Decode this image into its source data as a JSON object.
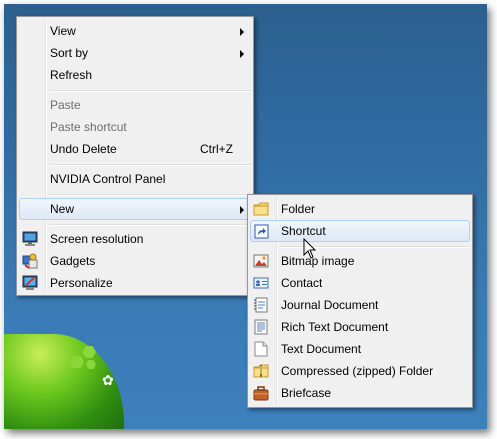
{
  "context_menu": {
    "items": [
      {
        "label": "View",
        "submenu": true
      },
      {
        "label": "Sort by",
        "submenu": true
      },
      {
        "label": "Refresh"
      },
      {
        "label": "Paste",
        "disabled": true
      },
      {
        "label": "Paste shortcut",
        "disabled": true
      },
      {
        "label": "Undo Delete",
        "shortcut": "Ctrl+Z"
      },
      {
        "label": "NVIDIA Control Panel"
      },
      {
        "label": "New",
        "submenu": true,
        "highlighted": true
      },
      {
        "label": "Screen resolution",
        "icon": "monitor-icon"
      },
      {
        "label": "Gadgets",
        "icon": "gadgets-icon"
      },
      {
        "label": "Personalize",
        "icon": "personalize-icon"
      }
    ]
  },
  "new_submenu": {
    "items": [
      {
        "label": "Folder",
        "icon": "folder-icon"
      },
      {
        "label": "Shortcut",
        "icon": "shortcut-icon",
        "highlighted": true
      },
      {
        "label": "Bitmap image",
        "icon": "bitmap-icon"
      },
      {
        "label": "Contact",
        "icon": "contact-icon"
      },
      {
        "label": "Journal Document",
        "icon": "journal-icon"
      },
      {
        "label": "Rich Text Document",
        "icon": "rich-text-icon"
      },
      {
        "label": "Text Document",
        "icon": "text-document-icon"
      },
      {
        "label": "Compressed (zipped) Folder",
        "icon": "zip-folder-icon"
      },
      {
        "label": "Briefcase",
        "icon": "briefcase-icon"
      }
    ]
  },
  "colors": {
    "menu_bg": "#f0f0f0",
    "hover_border": "#aecff7",
    "disabled_text": "#6d6d6d",
    "desktop": "#2f6aa0"
  }
}
